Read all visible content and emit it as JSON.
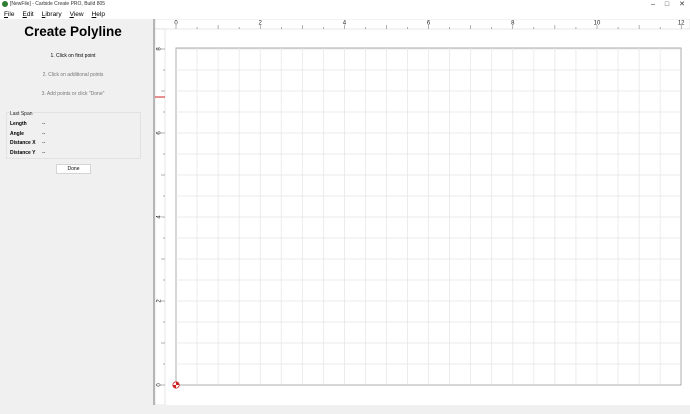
{
  "window": {
    "title": "[NewFile] - Carbide Create PRO, Build 805",
    "minimize_glyph": "–",
    "maximize_glyph": "□",
    "close_glyph": "✕"
  },
  "menu": [
    "File",
    "Edit",
    "Library",
    "View",
    "Help"
  ],
  "panel": {
    "title": "Create Polyline",
    "steps": [
      "1. Click on first point",
      "2. Click on additional points",
      "3. Add points or click \"Done\""
    ],
    "last_span": {
      "title": "Last Span",
      "rows": [
        {
          "label": "Length",
          "value": "--"
        },
        {
          "label": "Angle",
          "value": "--"
        },
        {
          "label": "Distance X",
          "value": "--"
        },
        {
          "label": "Distance Y",
          "value": "--"
        }
      ]
    },
    "done_label": "Done"
  },
  "canvas": {
    "x_ticks": [
      "0",
      "2",
      "4",
      "6",
      "8",
      "10",
      "12"
    ],
    "y_ticks": [
      "0",
      "2",
      "4",
      "6",
      "8"
    ],
    "marker_color": "#cc2222",
    "grid_color": "#e4e4e4",
    "origin_icon": "origin-marker-icon"
  }
}
